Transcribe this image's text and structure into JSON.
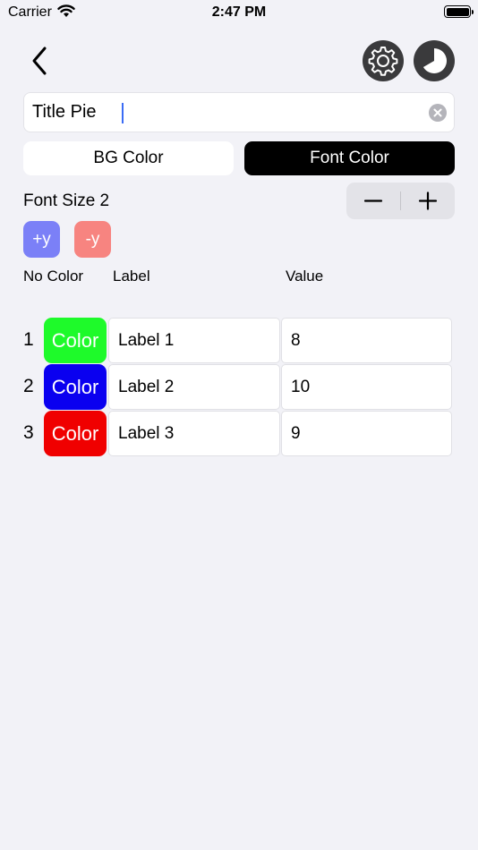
{
  "status_bar": {
    "carrier": "Carrier",
    "time": "2:47 PM"
  },
  "header": {
    "back_icon": "chevron-left-icon",
    "settings_icon": "gear-icon",
    "chart_icon": "pie-chart-icon"
  },
  "title_field": {
    "value": "Title Pie"
  },
  "color_toggle": {
    "bg_label": "BG Color",
    "font_label": "Font Color",
    "selected": "Font Color"
  },
  "font_size": {
    "label": "Font Size 2"
  },
  "y_buttons": {
    "plus_label": "+y",
    "minus_label": "-y"
  },
  "columns": {
    "no_color": "No Color",
    "label": "Label",
    "value": "Value"
  },
  "rows": [
    {
      "number": "1",
      "color_label": "Color",
      "color": "#1efa2a",
      "label": "Label 1",
      "value": "8"
    },
    {
      "number": "2",
      "color_label": "Color",
      "color": "#0a00f0",
      "label": "Label 2",
      "value": "10"
    },
    {
      "number": "3",
      "color_label": "Color",
      "color": "#f00000",
      "label": "Label 3",
      "value": "9"
    }
  ],
  "colors": {
    "background": "#f2f2f7",
    "accent_plus_y": "#7b80f7",
    "accent_minus_y": "#f78480",
    "toggle_selected": "#000000"
  }
}
